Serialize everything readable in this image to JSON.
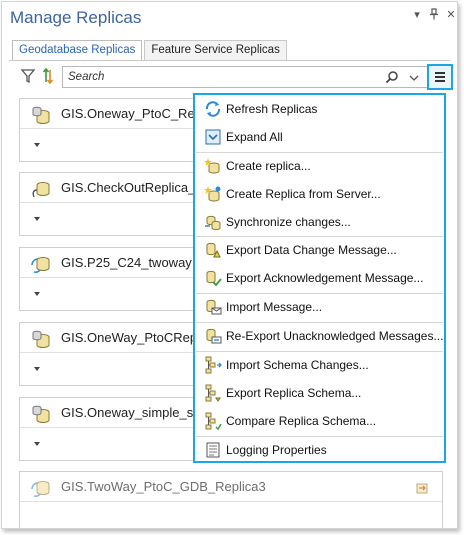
{
  "window": {
    "title": "Manage Replicas",
    "menu_glyph": "▾",
    "pin_glyph": "†",
    "close_glyph": "✕"
  },
  "tabs": [
    {
      "label": "Geodatabase Replicas",
      "active": true
    },
    {
      "label": "Feature Service Replicas",
      "active": false
    }
  ],
  "toolbar": {
    "filter_icon": "filter-icon",
    "sort_icon": "sort-icon"
  },
  "search": {
    "placeholder": "Search",
    "value": ""
  },
  "replicas": [
    {
      "name": "GIS.Oneway_PtoC_Rep",
      "icon": "oneway-replica-icon"
    },
    {
      "name": "GIS.CheckOutReplica_",
      "icon": "checkout-replica-icon"
    },
    {
      "name": "GIS.P25_C24_twoway",
      "icon": "twoway-replica-icon"
    },
    {
      "name": "GIS.OneWay_PtoCRep",
      "icon": "oneway-replica-icon"
    },
    {
      "name": "GIS.Oneway_simple_su",
      "icon": "oneway-replica-icon"
    },
    {
      "name": "GIS.TwoWay_PtoC_GDB_Replica3",
      "icon": "twoway-replica-icon"
    }
  ],
  "context_menu": {
    "items": [
      {
        "label": "Refresh Replicas",
        "icon": "refresh-icon"
      },
      {
        "label": "Expand All",
        "icon": "expand-all-icon"
      },
      {
        "label": "Create replica...",
        "icon": "create-replica-icon"
      },
      {
        "label": "Create Replica from Server...",
        "icon": "create-replica-server-icon"
      },
      {
        "label": "Synchronize changes...",
        "icon": "synchronize-icon"
      },
      {
        "label": "Export Data Change Message...",
        "icon": "export-data-change-icon"
      },
      {
        "label": "Export Acknowledgement Message...",
        "icon": "export-ack-icon"
      },
      {
        "label": "Import Message...",
        "icon": "import-message-icon"
      },
      {
        "label": "Re-Export Unacknowledged Messages...",
        "icon": "reexport-icon"
      },
      {
        "label": "Import Schema Changes...",
        "icon": "import-schema-icon"
      },
      {
        "label": "Export Replica Schema...",
        "icon": "export-schema-icon"
      },
      {
        "label": "Compare Replica Schema...",
        "icon": "compare-schema-icon"
      },
      {
        "label": "Logging Properties",
        "icon": "logging-icon"
      }
    ]
  },
  "colors": {
    "accent": "#1aa7e8",
    "title": "#3c64a0",
    "active_tab": "#2a64b5"
  }
}
